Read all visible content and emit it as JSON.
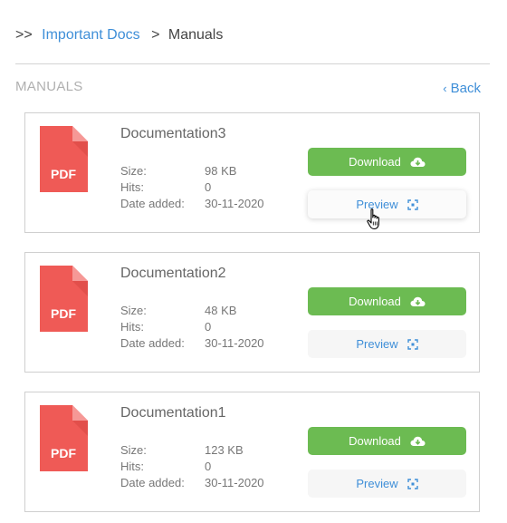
{
  "breadcrumb": {
    "prefix": ">>",
    "parent": "Important Docs",
    "separator": ">",
    "current": "Manuals"
  },
  "section": {
    "title": "MANUALS",
    "back_label": "Back"
  },
  "labels": {
    "size": "Size:",
    "hits": "Hits:",
    "date_added": "Date added:",
    "download": "Download",
    "preview": "Preview",
    "pdf": "PDF"
  },
  "documents": [
    {
      "title": "Documentation3",
      "size": "98 KB",
      "hits": "0",
      "date_added": "30-11-2020"
    },
    {
      "title": "Documentation2",
      "size": "48 KB",
      "hits": "0",
      "date_added": "30-11-2020"
    },
    {
      "title": "Documentation1",
      "size": "123 KB",
      "hits": "0",
      "date_added": "30-11-2020"
    }
  ],
  "colors": {
    "accent": "#3f8fd8",
    "download_button": "#6cbb52",
    "pdf_icon": "#ef5a56"
  },
  "icons": {
    "download": "cloud-download-icon",
    "preview": "fullscreen-icon",
    "file": "pdf-file-icon",
    "back": "chevron-left-icon"
  }
}
